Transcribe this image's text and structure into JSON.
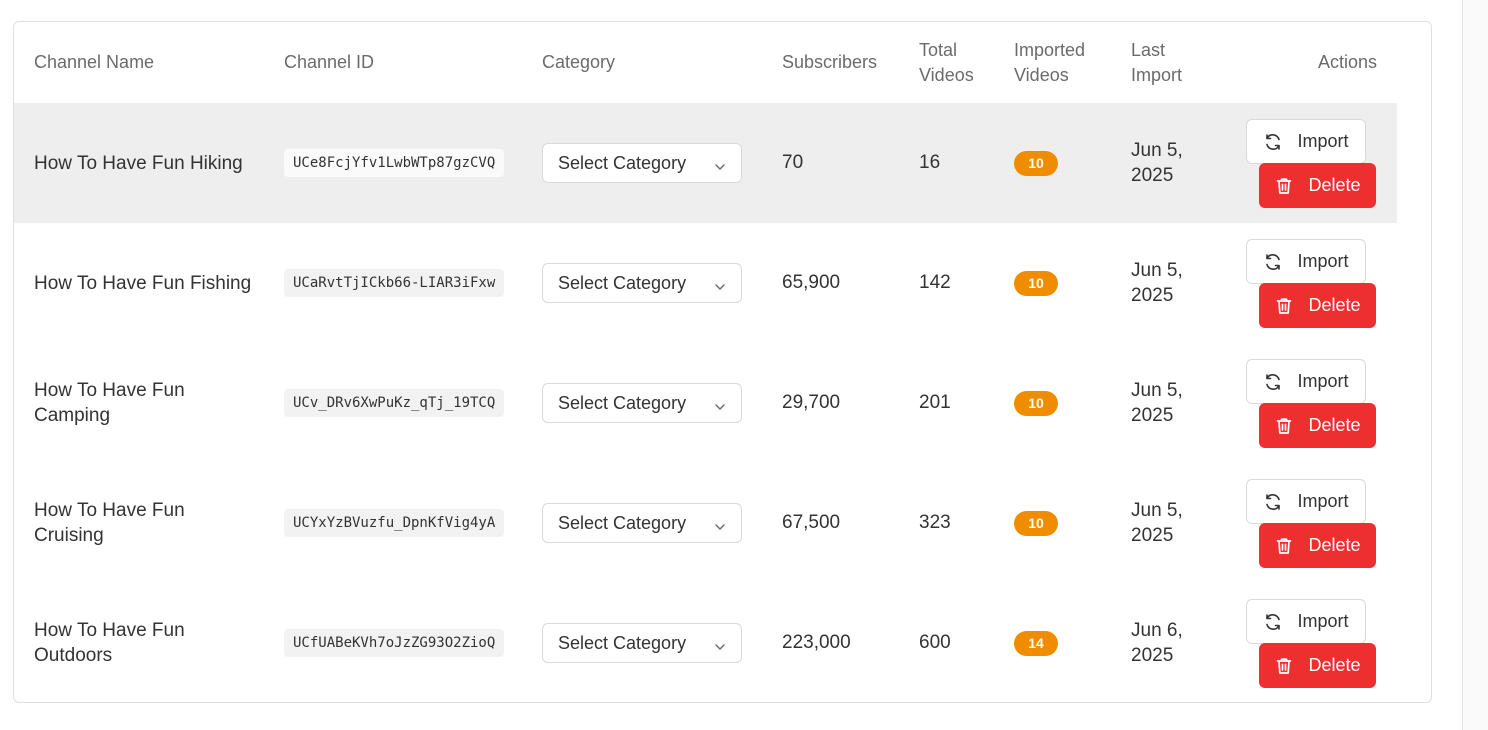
{
  "columns": {
    "channel_name": "Channel Name",
    "channel_id": "Channel ID",
    "category": "Category",
    "subscribers": "Subscribers",
    "total_videos_1": "Total",
    "total_videos_2": "Videos",
    "imported_videos_1": "Imported",
    "imported_videos_2": "Videos",
    "last_import_1": "Last",
    "last_import_2": "Import",
    "actions": "Actions"
  },
  "rows": [
    {
      "name": "How To Have Fun Hiking",
      "id": "UCe8FcjYfv1LwbWTp87gzCVQ",
      "category": "Select Category",
      "subscribers": "70",
      "total": "16",
      "imported": "10",
      "last_1": "Jun 5,",
      "last_2": "2025",
      "import_label": "Import",
      "delete_label": "Delete"
    },
    {
      "name": "How To Have Fun Fishing",
      "id": "UCaRvtTjICkb66-LIAR3iFxw",
      "category": "Select Category",
      "subscribers": "65,900",
      "total": "142",
      "imported": "10",
      "last_1": "Jun 5,",
      "last_2": "2025",
      "import_label": "Import",
      "delete_label": "Delete"
    },
    {
      "name": "How To Have Fun Camping",
      "id": "UCv_DRv6XwPuKz_qTj_19TCQ",
      "category": "Select Category",
      "subscribers": "29,700",
      "total": "201",
      "imported": "10",
      "last_1": "Jun 5,",
      "last_2": "2025",
      "import_label": "Import",
      "delete_label": "Delete"
    },
    {
      "name": "How To Have Fun Cruising",
      "id": "UCYxYzBVuzfu_DpnKfVig4yA",
      "category": "Select Category",
      "subscribers": "67,500",
      "total": "323",
      "imported": "10",
      "last_1": "Jun 5,",
      "last_2": "2025",
      "import_label": "Import",
      "delete_label": "Delete"
    },
    {
      "name": "How To Have Fun Outdoors",
      "id": "UCfUABeKVh7oJzZG93O2ZioQ",
      "category": "Select Category",
      "subscribers": "223,000",
      "total": "600",
      "imported": "14",
      "last_1": "Jun 6,",
      "last_2": "2025",
      "import_label": "Import",
      "delete_label": "Delete"
    }
  ],
  "colors": {
    "badge": "#f08c00",
    "delete": "#ee2f2f",
    "hover_row": "#eeeeee"
  },
  "icons": {
    "import": "refresh-icon",
    "delete": "trash-icon",
    "select": "chevron-down-icon"
  }
}
